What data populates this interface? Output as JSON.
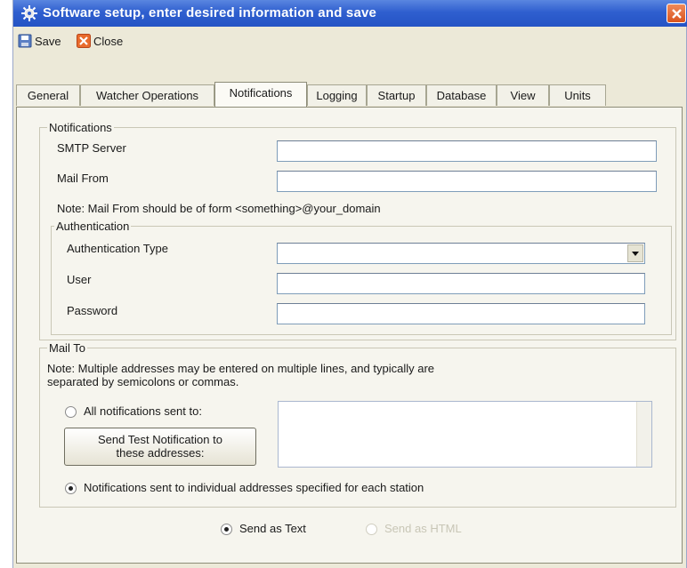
{
  "window": {
    "title": "Software setup, enter desired information and save"
  },
  "toolbar": {
    "save_label": "Save",
    "close_label": "Close"
  },
  "tabs": [
    {
      "label": "General"
    },
    {
      "label": "Watcher Operations"
    },
    {
      "label": "Notifications",
      "active": true
    },
    {
      "label": "Logging"
    },
    {
      "label": "Startup"
    },
    {
      "label": "Database"
    },
    {
      "label": "View"
    },
    {
      "label": "Units"
    }
  ],
  "notifications": {
    "group_label": "Notifications",
    "smtp_label": "SMTP Server",
    "smtp_value": "",
    "mail_from_label": "Mail From",
    "mail_from_value": "",
    "note": "Note: Mail From should be of form <something>@your_domain"
  },
  "authentication": {
    "group_label": "Authentication",
    "type_label": "Authentication Type",
    "type_value": "",
    "user_label": "User",
    "user_value": "",
    "password_label": "Password",
    "password_value": ""
  },
  "mail_to": {
    "group_label": "Mail To",
    "note_line1": "Note: Multiple addresses may be entered on multiple lines, and typically are",
    "note_line2": "separated by semicolons or commas.",
    "all_sent_label": "All notifications sent to:",
    "all_sent_selected": false,
    "test_button_line1": "Send Test Notification to",
    "test_button_line2": "these addresses:",
    "addresses_value": "",
    "individual_label": "Notifications sent to individual addresses specified for each station",
    "individual_selected": true
  },
  "format": {
    "text_label": "Send as Text",
    "text_selected": true,
    "html_label": "Send as HTML",
    "html_selected": false,
    "html_enabled": false
  },
  "colors": {
    "titlebar": "#2f5fcf",
    "close_button": "#d9541e",
    "panel_background": "#f6f5ee"
  }
}
